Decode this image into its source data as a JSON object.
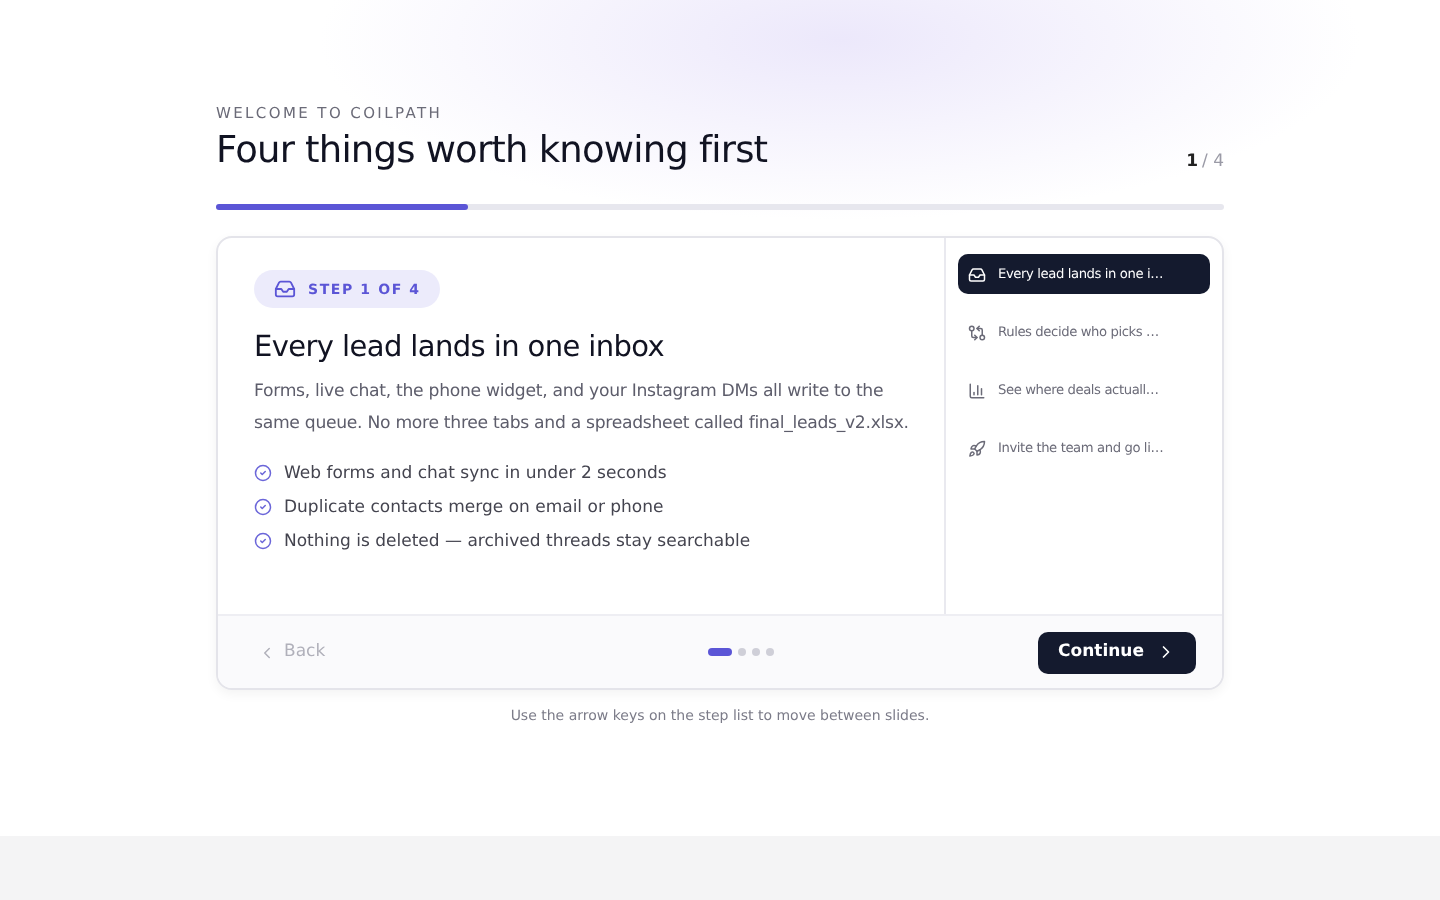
{
  "header": {
    "eyebrow": "WELCOME TO COILPATH",
    "title": "Four things worth knowing first",
    "counter_current": "1",
    "counter_total": "/ 4",
    "progress": {
      "level": 0.25
    }
  },
  "slide": {
    "badge": "STEP 1 OF 4",
    "heading": "Every lead lands in one inbox",
    "body": "Forms, live chat, the phone widget, and your Instagram DMs all write to the same queue. No more three tabs and a spreadsheet called final_leads_v2.xlsx.",
    "points": [
      {
        "text": "Web forms and chat sync in under 2 seconds",
        "checked": true
      },
      {
        "text": "Duplicate contacts merge on email or phone",
        "checked": true
      },
      {
        "text": "Nothing is deleted — archived threads stay searchable",
        "checked": true
      }
    ]
  },
  "steps": [
    {
      "label": "Every lead lands in one i…",
      "kind": "inbox",
      "selected": true
    },
    {
      "label": "Rules decide who picks …",
      "kind": "route",
      "selected": false
    },
    {
      "label": "See where deals actuall…",
      "kind": "chart",
      "selected": false
    },
    {
      "label": "Invite the team and go li…",
      "kind": "rocket",
      "selected": false
    }
  ],
  "footer": {
    "back": {
      "label": "Back",
      "disabled": true
    },
    "dots": [
      {
        "selected": true
      },
      {
        "selected": false
      },
      {
        "selected": false
      },
      {
        "selected": false
      }
    ],
    "continue": "Continue"
  },
  "hint": "Use the arrow keys on the step list to move between slides."
}
